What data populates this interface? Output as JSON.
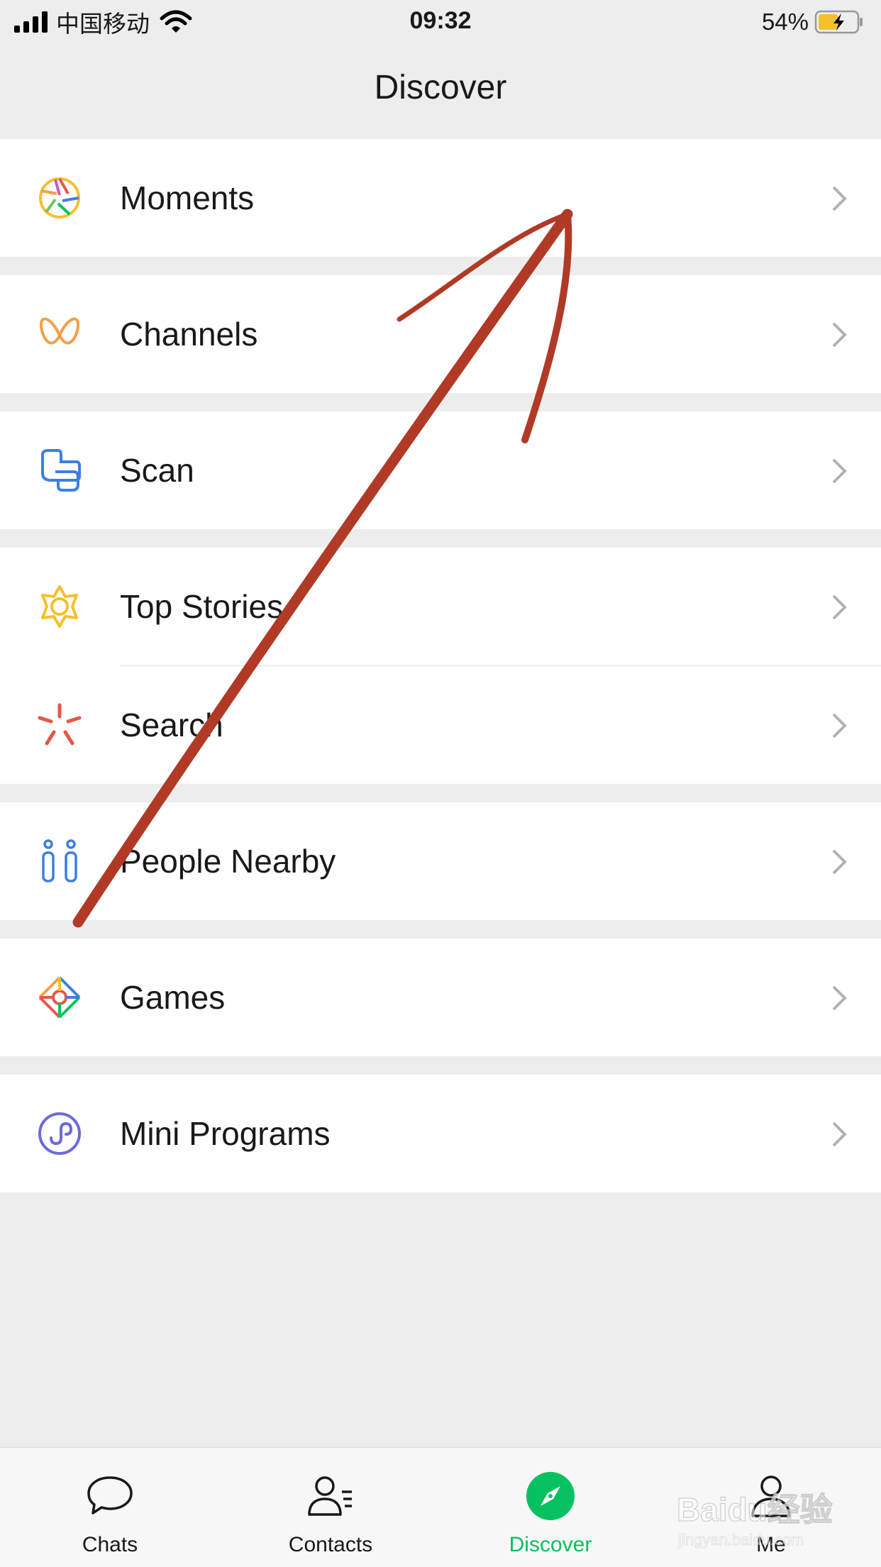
{
  "status_bar": {
    "carrier": "中国移动",
    "time": "09:32",
    "battery_percent": "54%",
    "battery_level": 0.54,
    "icons": [
      "signal-icon",
      "wifi-icon",
      "battery-charging-icon"
    ]
  },
  "header": {
    "title": "Discover"
  },
  "menu": {
    "moments": {
      "label": "Moments",
      "icon": "moments-aperture-icon",
      "color": "#f2a93b"
    },
    "channels": {
      "label": "Channels",
      "icon": "channels-butterfly-icon",
      "color": "#f2a049"
    },
    "scan": {
      "label": "Scan",
      "icon": "scan-icon",
      "color": "#3d7fe0"
    },
    "top_stories": {
      "label": "Top Stories",
      "icon": "top-stories-star-icon",
      "color": "#f5c02b"
    },
    "search": {
      "label": "Search",
      "icon": "search-sparkle-icon",
      "color": "#e85648"
    },
    "people_nearby": {
      "label": "People Nearby",
      "icon": "people-nearby-icon",
      "color": "#3d7fe0"
    },
    "games": {
      "label": "Games",
      "icon": "games-diamond-icon",
      "color": "#f2a049"
    },
    "mini_programs": {
      "label": "Mini Programs",
      "icon": "mini-programs-icon",
      "color": "#6b6bd8"
    }
  },
  "tab_bar": {
    "chats": {
      "label": "Chats",
      "icon": "chat-bubble-icon"
    },
    "contacts": {
      "label": "Contacts",
      "icon": "contacts-icon"
    },
    "discover": {
      "label": "Discover",
      "icon": "compass-icon",
      "active": true
    },
    "me": {
      "label": "Me",
      "icon": "person-icon"
    }
  },
  "colors": {
    "accent": "#07c160",
    "annotation": "#b03a26",
    "background": "#ededed"
  },
  "overlay": {
    "annotation": "hand-drawn-arrow",
    "watermark_text": "Baidu经验",
    "watermark_url": "jingyan.baidu.com"
  }
}
